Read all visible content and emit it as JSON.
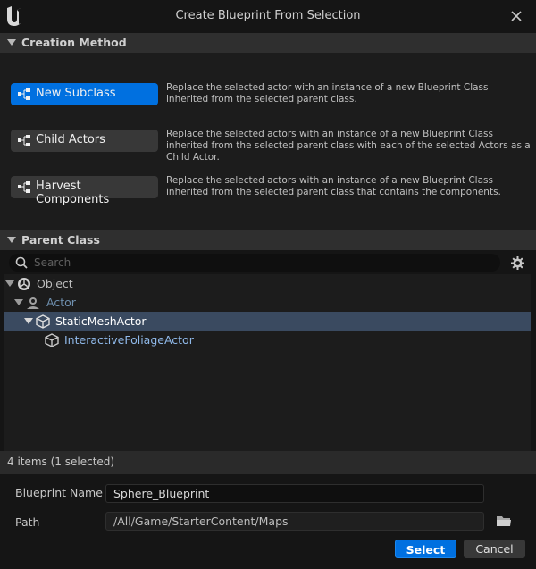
{
  "window": {
    "title": "Create Blueprint From Selection"
  },
  "creation_method": {
    "header": "Creation Method",
    "options": [
      {
        "label": "New Subclass",
        "description": "Replace the selected actor with an instance of a new Blueprint Class inherited from the selected parent class.",
        "selected": true
      },
      {
        "label": "Child Actors",
        "description": "Replace the selected actors with an instance of a new Blueprint Class inherited from the selected parent class with each of the selected Actors as a Child Actor.",
        "selected": false
      },
      {
        "label": "Harvest Components",
        "description": "Replace the selected actors with an instance of a new Blueprint Class inherited from the selected parent class that contains the components.",
        "selected": false
      }
    ]
  },
  "parent_class": {
    "header": "Parent Class",
    "search_placeholder": "Search",
    "tree": [
      {
        "label": "Object",
        "icon": "object-icon",
        "depth": 0,
        "expanded": true,
        "selected": false,
        "color": "#bdbdbd"
      },
      {
        "label": "Actor",
        "icon": "actor-icon",
        "depth": 1,
        "expanded": true,
        "selected": false,
        "color": "#6e8fae"
      },
      {
        "label": "StaticMeshActor",
        "icon": "static-mesh-icon",
        "depth": 2,
        "expanded": true,
        "selected": true,
        "color": "#ffffff"
      },
      {
        "label": "InteractiveFoliageActor",
        "icon": "static-mesh-icon",
        "depth": 3,
        "expanded": false,
        "selected": false,
        "color": "#8fb8e8"
      }
    ],
    "status": "4 items (1 selected)"
  },
  "form": {
    "blueprint_name_label": "Blueprint Name",
    "blueprint_name_value": "Sphere_Blueprint",
    "path_label": "Path",
    "path_value": "/All/Game/StarterContent/Maps"
  },
  "buttons": {
    "select": "Select",
    "cancel": "Cancel"
  },
  "colors": {
    "accent": "#0070e0",
    "selected_row": "#3a4a60"
  }
}
